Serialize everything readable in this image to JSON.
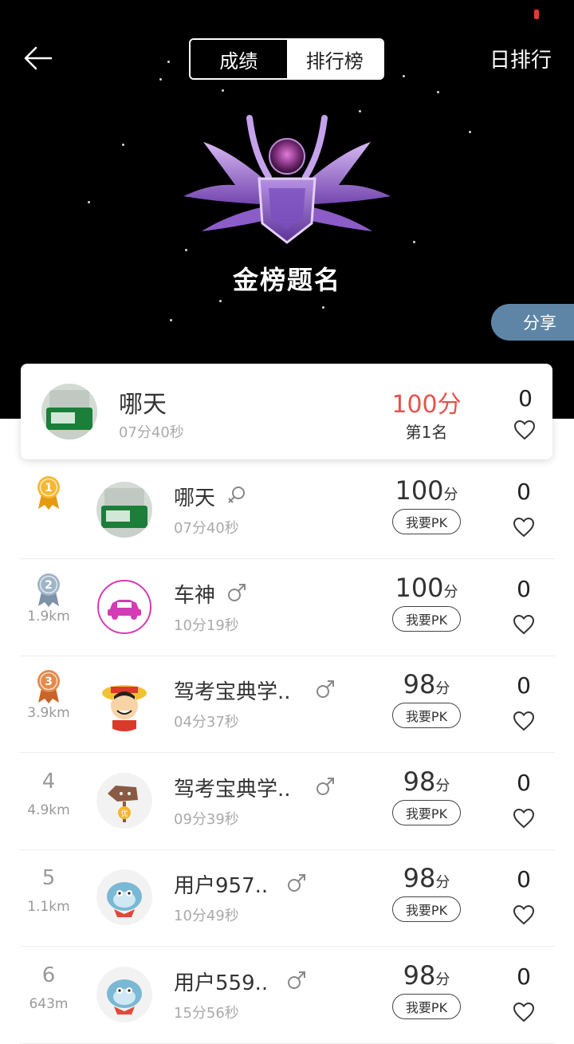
{
  "header": {
    "tabs": [
      {
        "label": "成绩"
      },
      {
        "label": "排行榜"
      }
    ],
    "period_label": "日排行",
    "hero_title": "金榜题名",
    "share_label": "分享"
  },
  "my_card": {
    "name": "哪天",
    "time": "07分40秒",
    "score": "100分",
    "rank": "第1名",
    "likes": "0"
  },
  "ranking": [
    {
      "rank": "1",
      "medal": "gold",
      "distance": "",
      "name": "哪天",
      "gender": "female",
      "time": "07分40秒",
      "score": "100",
      "unit": "分",
      "pk": "我要PK",
      "likes": "0",
      "avatar": "bottle"
    },
    {
      "rank": "2",
      "medal": "silver",
      "distance": "1.9km",
      "name": "车神",
      "gender": "male",
      "time": "10分19秒",
      "score": "100",
      "unit": "分",
      "pk": "我要PK",
      "likes": "0",
      "avatar": "car"
    },
    {
      "rank": "3",
      "medal": "bronze",
      "distance": "3.9km",
      "name": "驾考宝典学..",
      "gender": "male",
      "time": "04分37秒",
      "score": "98",
      "unit": "分",
      "pk": "我要PK",
      "likes": "0",
      "avatar": "luffy"
    },
    {
      "rank": "4",
      "medal": "",
      "distance": "4.9km",
      "name": "驾考宝典学..",
      "gender": "male",
      "time": "09分39秒",
      "score": "98",
      "unit": "分",
      "pk": "我要PK",
      "likes": "0",
      "avatar": "sign"
    },
    {
      "rank": "5",
      "medal": "",
      "distance": "1.1km",
      "name": "用户957..",
      "gender": "male",
      "time": "10分49秒",
      "score": "98",
      "unit": "分",
      "pk": "我要PK",
      "likes": "0",
      "avatar": "blue"
    },
    {
      "rank": "6",
      "medal": "",
      "distance": "643m",
      "name": "用户559..",
      "gender": "male",
      "time": "15分56秒",
      "score": "98",
      "unit": "分",
      "pk": "我要PK",
      "likes": "0",
      "avatar": "blue"
    }
  ],
  "colors": {
    "score_highlight": "#e5534b",
    "share_bg": "#5e85a6",
    "badge_purple": "#9b6fd1"
  }
}
